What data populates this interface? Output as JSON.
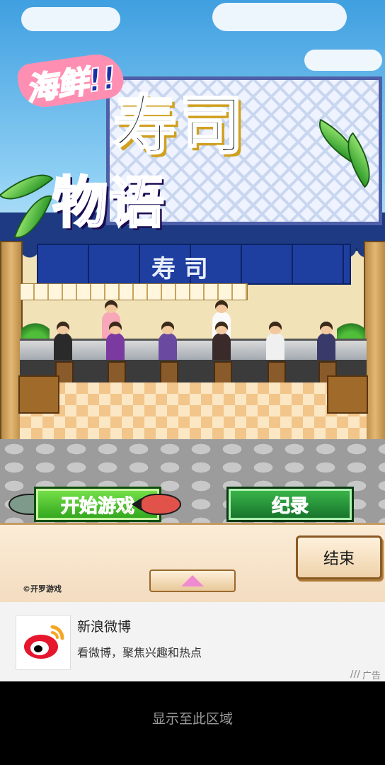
{
  "game": {
    "logo_small": "海鲜!!",
    "logo_big_1": "寿司",
    "logo_big_2": "物语",
    "shop_sign": "寿 司"
  },
  "buttons": {
    "start": "开始游戏",
    "record": "纪录",
    "end": "结束"
  },
  "copyright": "©开罗游戏",
  "ad": {
    "title": "新浪微博",
    "description": "看微博，聚焦兴趣和热点",
    "tag": "广告"
  },
  "bottom_note": "显示至此区域",
  "colors": {
    "start_text": "#e8202a",
    "record_text": "#31a9ff",
    "ad_background": "#f3f3f3"
  }
}
